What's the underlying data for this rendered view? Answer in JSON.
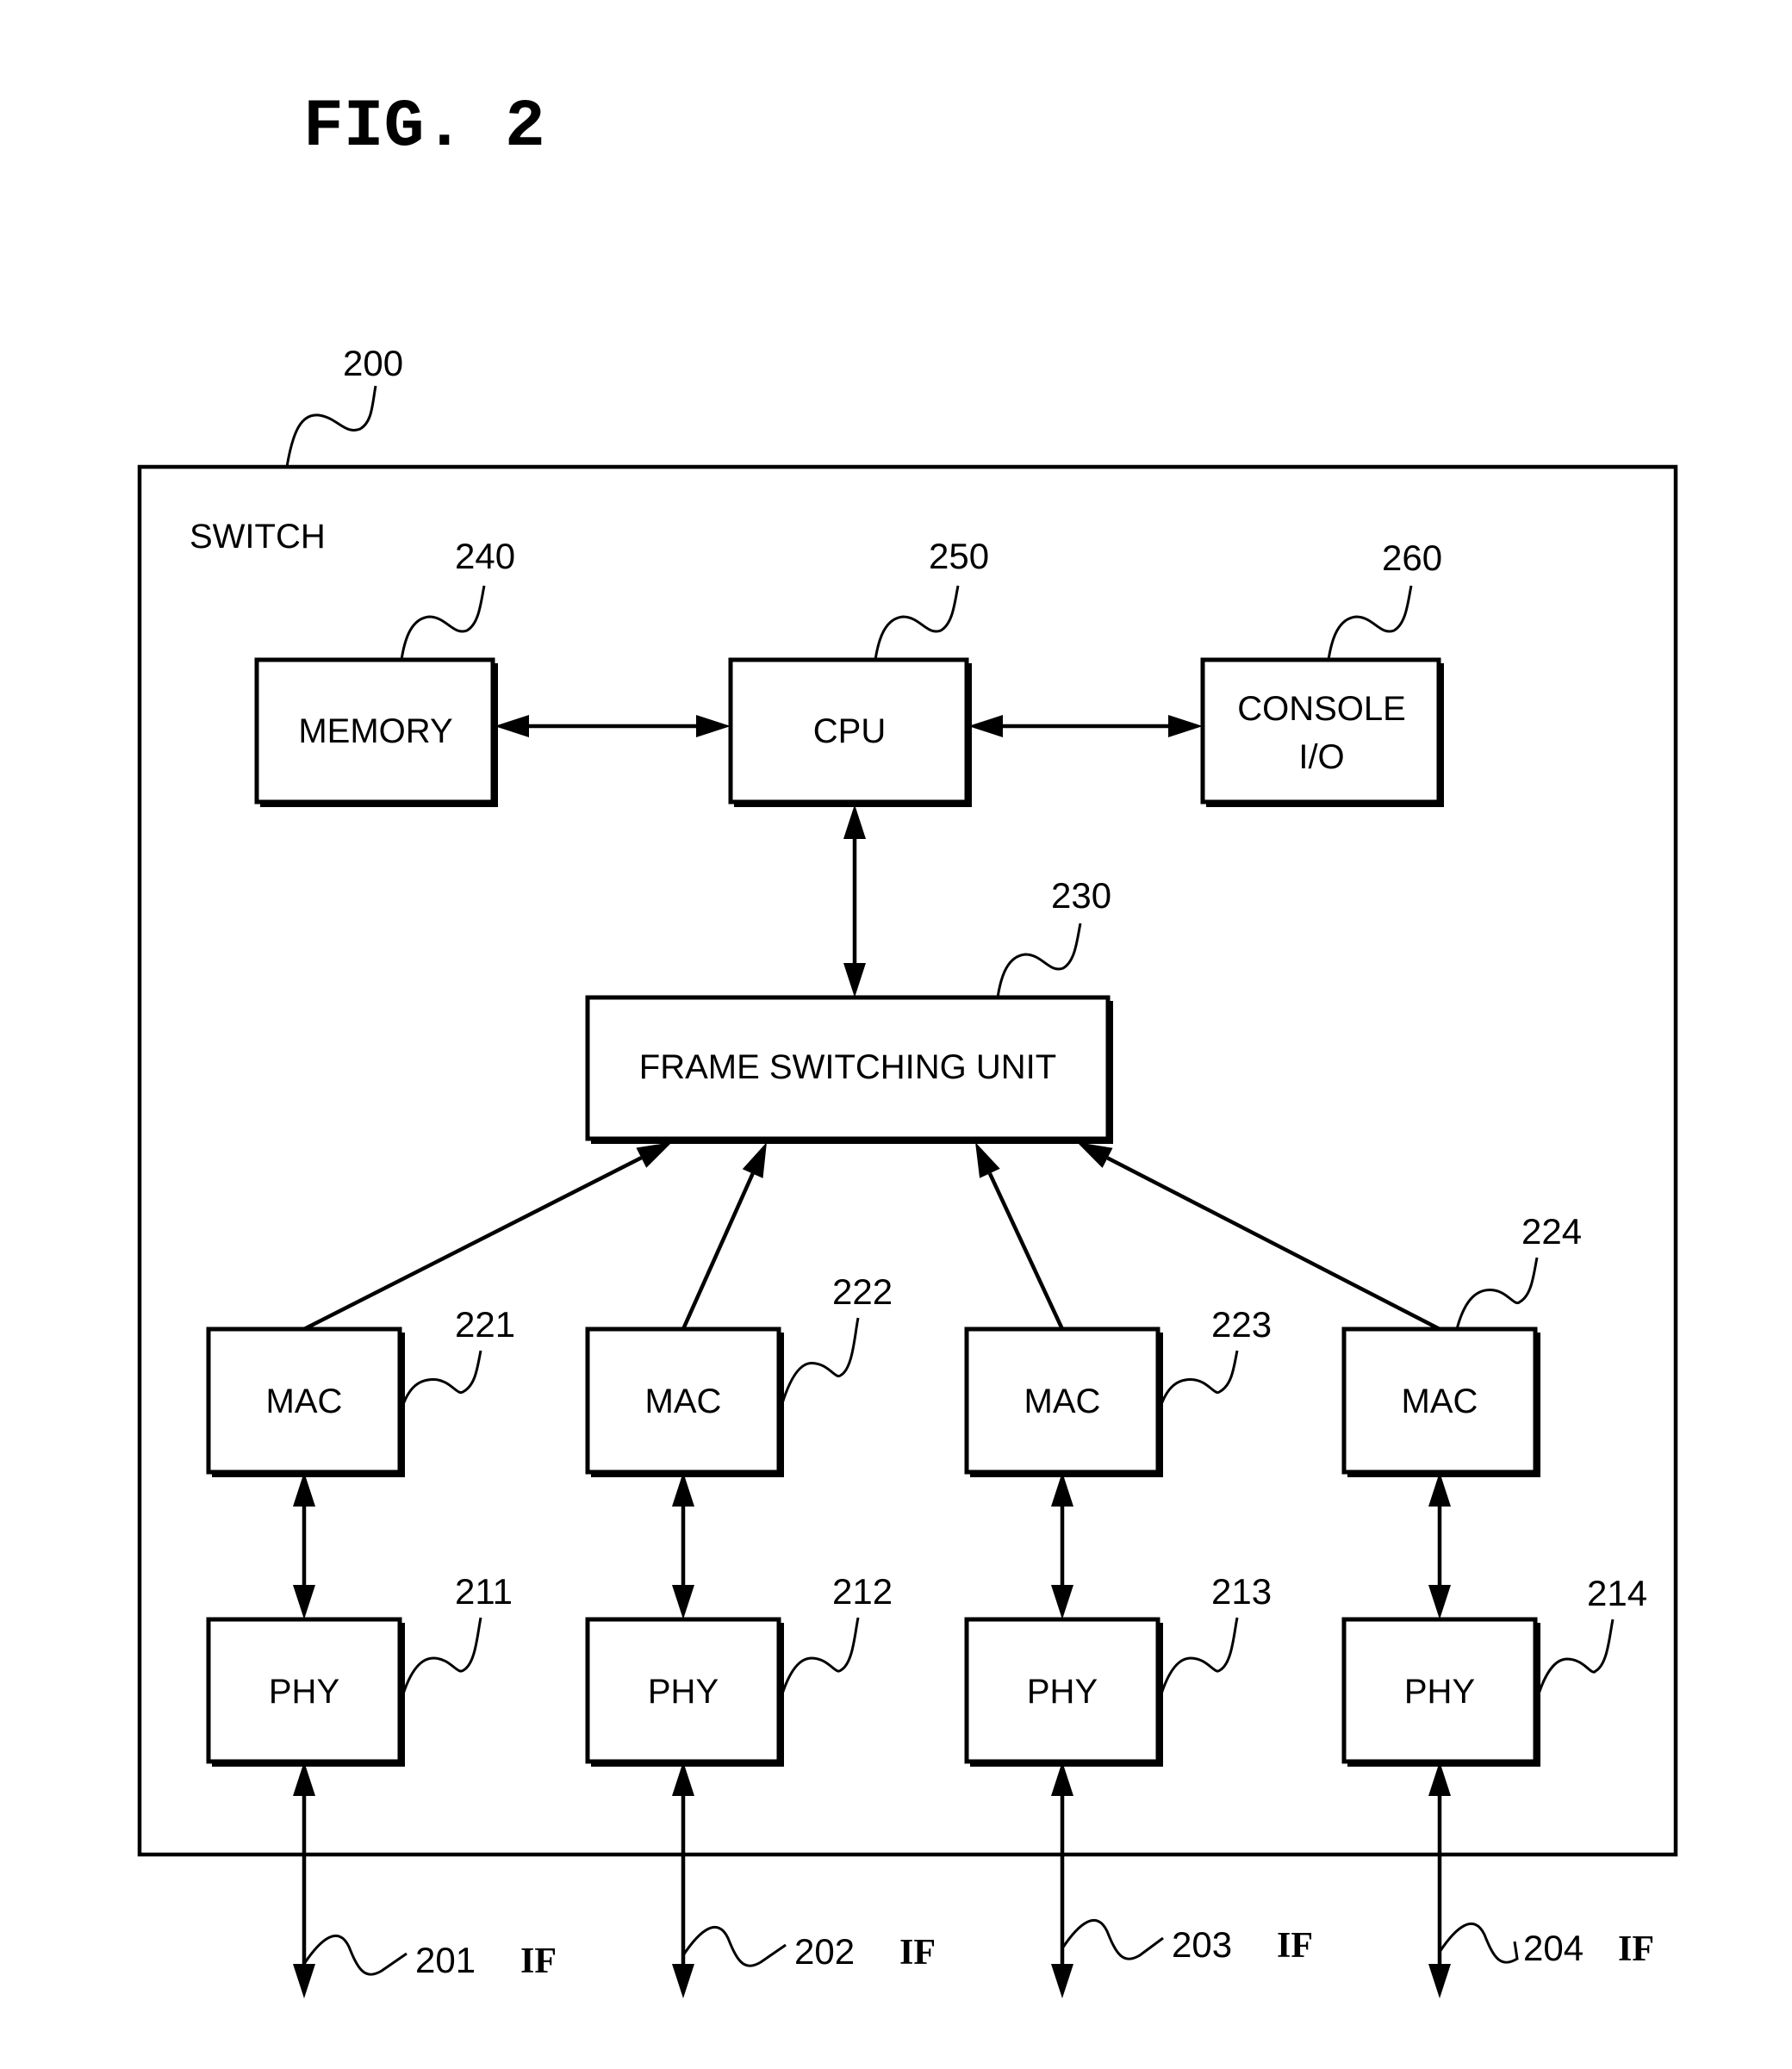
{
  "figure": {
    "title": "FIG. 2",
    "container": {
      "ref": "200",
      "label": "SWITCH"
    }
  },
  "blocks": {
    "memory": {
      "ref": "240",
      "label": "MEMORY"
    },
    "cpu": {
      "ref": "250",
      "label": "CPU"
    },
    "console": {
      "ref": "260",
      "label_line1": "CONSOLE",
      "label_line2": "I/O"
    },
    "fsu": {
      "ref": "230",
      "label": "FRAME SWITCHING UNIT"
    }
  },
  "macs": [
    {
      "ref": "221",
      "label": "MAC"
    },
    {
      "ref": "222",
      "label": "MAC"
    },
    {
      "ref": "223",
      "label": "MAC"
    },
    {
      "ref": "224",
      "label": "MAC"
    }
  ],
  "phys": [
    {
      "ref": "211",
      "label": "PHY"
    },
    {
      "ref": "212",
      "label": "PHY"
    },
    {
      "ref": "213",
      "label": "PHY"
    },
    {
      "ref": "214",
      "label": "PHY"
    }
  ],
  "interfaces": [
    {
      "ref": "201",
      "label": "IF"
    },
    {
      "ref": "202",
      "label": "IF"
    },
    {
      "ref": "203",
      "label": "IF"
    },
    {
      "ref": "204",
      "label": "IF"
    }
  ],
  "connections": [
    {
      "from": "memory",
      "to": "cpu",
      "direction": "bidirectional"
    },
    {
      "from": "cpu",
      "to": "console",
      "direction": "bidirectional"
    },
    {
      "from": "cpu",
      "to": "fsu",
      "direction": "bidirectional"
    },
    {
      "from": "mac-221",
      "to": "fsu",
      "direction": "to"
    },
    {
      "from": "mac-222",
      "to": "fsu",
      "direction": "to"
    },
    {
      "from": "mac-223",
      "to": "fsu",
      "direction": "to"
    },
    {
      "from": "mac-224",
      "to": "fsu",
      "direction": "to"
    },
    {
      "from": "mac-221",
      "to": "phy-211",
      "direction": "bidirectional"
    },
    {
      "from": "mac-222",
      "to": "phy-212",
      "direction": "bidirectional"
    },
    {
      "from": "mac-223",
      "to": "phy-213",
      "direction": "bidirectional"
    },
    {
      "from": "mac-224",
      "to": "phy-214",
      "direction": "bidirectional"
    },
    {
      "from": "phy-211",
      "to": "if-201",
      "direction": "bidirectional"
    },
    {
      "from": "phy-212",
      "to": "if-202",
      "direction": "bidirectional"
    },
    {
      "from": "phy-213",
      "to": "if-203",
      "direction": "bidirectional"
    },
    {
      "from": "phy-214",
      "to": "if-204",
      "direction": "bidirectional"
    }
  ]
}
